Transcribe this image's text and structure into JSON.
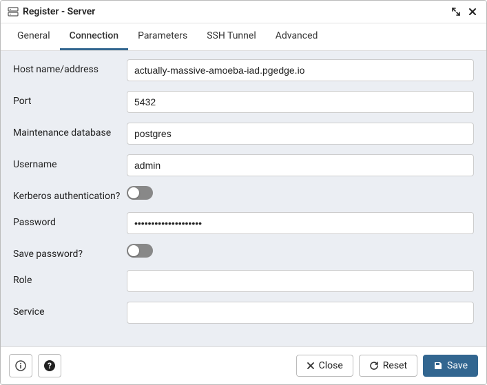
{
  "title": "Register - Server",
  "tabs": [
    "General",
    "Connection",
    "Parameters",
    "SSH Tunnel",
    "Advanced"
  ],
  "activeTabIndex": 1,
  "fields": {
    "host_label": "Host name/address",
    "host_value": "actually-massive-amoeba-iad.pgedge.io",
    "port_label": "Port",
    "port_value": "5432",
    "maintdb_label": "Maintenance database",
    "maintdb_value": "postgres",
    "username_label": "Username",
    "username_value": "admin",
    "kerberos_label": "Kerberos authentication?",
    "kerberos_on": false,
    "password_label": "Password",
    "password_value": "••••••••••••••••••••",
    "savepw_label": "Save password?",
    "savepw_on": false,
    "role_label": "Role",
    "role_value": "",
    "service_label": "Service",
    "service_value": ""
  },
  "footer": {
    "close_label": "Close",
    "reset_label": "Reset",
    "save_label": "Save"
  }
}
